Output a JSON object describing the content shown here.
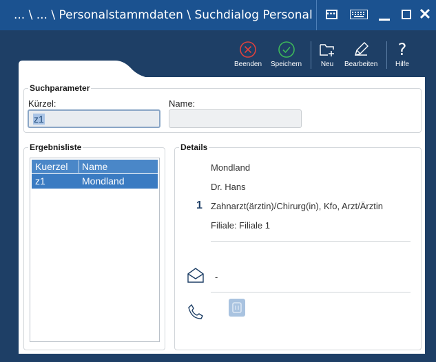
{
  "window": {
    "title": "... \\ ... \\ Personalstammdaten \\ Suchdialog Personal",
    "buttons": {
      "dots_icon": "ellipsis-icon",
      "keyboard_icon": "keyboard-icon",
      "minimize_icon": "minimize-icon",
      "maximize_icon": "maximize-icon",
      "close_icon": "close-icon"
    }
  },
  "toolbar": {
    "beenden": "Beenden",
    "speichern": "Speichern",
    "neu": "Neu",
    "bearbeiten": "Bearbeiten",
    "hilfe": "Hilfe"
  },
  "suchparameter": {
    "legend": "Suchparameter",
    "kuerzel_label": "Kürzel:",
    "kuerzel_value": "z1",
    "name_label": "Name:",
    "name_value": ""
  },
  "ergebnisliste": {
    "legend": "Ergebnisliste",
    "columns": [
      "Kuerzel",
      "Name"
    ],
    "rows": [
      [
        "z1",
        "Mondland"
      ]
    ]
  },
  "details": {
    "legend": "Details",
    "number": "1",
    "lines": [
      "Mondland",
      "Dr. Hans",
      "Zahnarzt(ärztin)/Chirurg(in), Kfo, Arzt/Ärztin",
      "Filiale: Filiale 1"
    ],
    "email": "-"
  },
  "colors": {
    "titlebar": "#1b5290",
    "background": "#1e3f66",
    "selection": "#3a7bc2",
    "beenden_icon": "#e0413c",
    "speichern_icon": "#3db85a"
  }
}
